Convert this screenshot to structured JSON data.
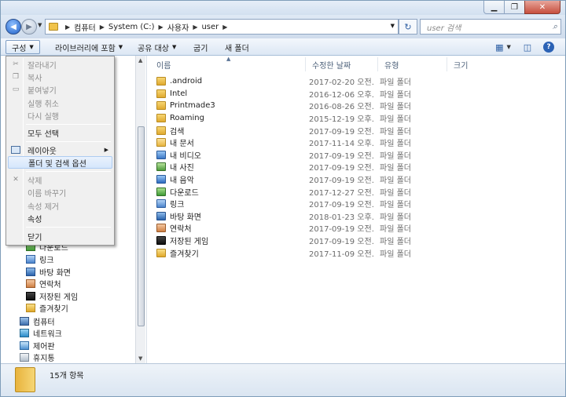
{
  "window": {
    "min_glyph": "▁",
    "max_glyph": "❐",
    "close_glyph": "✕"
  },
  "address": {
    "crumbs": [
      "컴퓨터",
      "System (C:)",
      "사용자",
      "user"
    ],
    "search_placeholder": "user 검색"
  },
  "toolbar": {
    "organize": "구성",
    "include_library": "라이브러리에 포함",
    "share": "공유 대상",
    "burn": "굽기",
    "new_folder": "새 폴더"
  },
  "columns": {
    "name": "이름",
    "date": "수정한 날짜",
    "type": "유형",
    "size": "크기"
  },
  "files": [
    {
      "name": ".android",
      "date": "2017-02-20 오전...",
      "type": "파일 폴더",
      "icon": "folder"
    },
    {
      "name": "Intel",
      "date": "2016-12-06 오후...",
      "type": "파일 폴더",
      "icon": "folder"
    },
    {
      "name": "Printmade3",
      "date": "2016-08-26 오전...",
      "type": "파일 폴더",
      "icon": "folder"
    },
    {
      "name": "Roaming",
      "date": "2015-12-19 오후...",
      "type": "파일 폴더",
      "icon": "folder"
    },
    {
      "name": "검색",
      "date": "2017-09-19 오전...",
      "type": "파일 폴더",
      "icon": "search-folder"
    },
    {
      "name": "내 문서",
      "date": "2017-11-14 오후...",
      "type": "파일 폴더",
      "icon": "documents-folder"
    },
    {
      "name": "내 비디오",
      "date": "2017-09-19 오전...",
      "type": "파일 폴더",
      "icon": "videos-folder"
    },
    {
      "name": "내 사진",
      "date": "2017-09-19 오전...",
      "type": "파일 폴더",
      "icon": "pictures-folder"
    },
    {
      "name": "내 음악",
      "date": "2017-09-19 오전...",
      "type": "파일 폴더",
      "icon": "music-folder"
    },
    {
      "name": "다운로드",
      "date": "2017-12-27 오전...",
      "type": "파일 폴더",
      "icon": "downloads-folder"
    },
    {
      "name": "링크",
      "date": "2017-09-19 오전...",
      "type": "파일 폴더",
      "icon": "links-folder"
    },
    {
      "name": "바탕 화면",
      "date": "2018-01-23 오후...",
      "type": "파일 폴더",
      "icon": "desktop-folder"
    },
    {
      "name": "연락처",
      "date": "2017-09-19 오전...",
      "type": "파일 폴더",
      "icon": "contacts-folder"
    },
    {
      "name": "저장된 게임",
      "date": "2017-09-19 오전...",
      "type": "파일 폴더",
      "icon": "saved-games-folder"
    },
    {
      "name": "즐겨찾기",
      "date": "2017-11-09 오전...",
      "type": "파일 폴더",
      "icon": "favorites-folder"
    }
  ],
  "nav": {
    "items": [
      {
        "label": "다운로드",
        "icon": "downloads-folder"
      },
      {
        "label": "링크",
        "icon": "links-folder"
      },
      {
        "label": "바탕 화면",
        "icon": "desktop-folder"
      },
      {
        "label": "연락처",
        "icon": "contacts-folder"
      },
      {
        "label": "저장된 게임",
        "icon": "saved-games-folder"
      },
      {
        "label": "즐겨찾기",
        "icon": "favorites-folder"
      },
      {
        "label": "컴퓨터",
        "icon": "computer"
      },
      {
        "label": "네트워크",
        "icon": "network"
      },
      {
        "label": "제어판",
        "icon": "control-panel"
      },
      {
        "label": "휴지통",
        "icon": "recycle-bin"
      }
    ]
  },
  "menu": {
    "cut": "잘라내기",
    "copy": "복사",
    "paste": "붙여넣기",
    "undo": "실행 취소",
    "redo": "다시 실행",
    "select_all": "모두 선택",
    "layout": "레이아웃",
    "folder_options": "폴더 및 검색 옵션",
    "delete": "삭제",
    "rename": "이름 바꾸기",
    "remove_properties": "속성 제거",
    "properties": "속성",
    "close": "닫기"
  },
  "status": {
    "count": "15개 항목"
  }
}
